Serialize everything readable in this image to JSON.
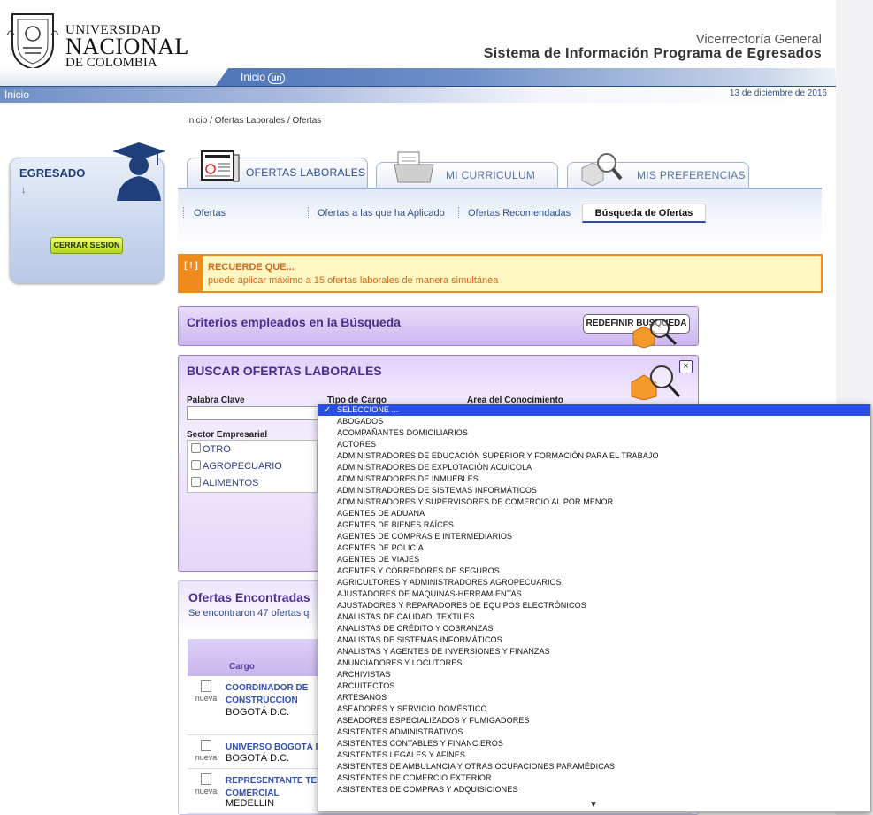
{
  "header": {
    "logo_line1": "UNIVERSIDAD",
    "logo_line2": "NACIONAL",
    "logo_line3": "DE COLOMBIA",
    "vice": "Vicerrectoría General",
    "system": "Sistema de Información Programa de Egresados",
    "nav_inicio": "Inicio",
    "nav_un": "un",
    "home": "Inicio",
    "date": "13 de diciembre de 2016"
  },
  "breadcrumb": "Inicio / Ofertas Laborales / Ofertas",
  "sidebar": {
    "title": "EGRESADO",
    "arrow": "↓",
    "logout": "CERRAR SESION"
  },
  "tabs": [
    "OFERTAS LABORALES",
    "MI CURRICULUM",
    "MIS PREFERENCIAS"
  ],
  "subnav": {
    "items": [
      "Ofertas",
      "Ofertas a las que ha Aplicado",
      "Ofertas Recomendadas"
    ],
    "active": "Búsqueda de Ofertas"
  },
  "alert": {
    "icon": "[ ! ]",
    "title": "RECUERDE QUE...",
    "message": "puede aplicar máximo a 15 ofertas laborales de manera simultánea"
  },
  "criterios": {
    "title": "Criterios empleados en la Búsqueda",
    "button": "REDEFINIR BUSQUEDA"
  },
  "buscar": {
    "title": "BUSCAR OFERTAS LABORALES",
    "close": "×",
    "label_palabra": "Palabra Clave",
    "label_tipo": "Tipo de Cargo",
    "label_area": "Area del Conocimiento",
    "label_sector": "Sector Empresarial",
    "sectors": [
      "OTRO",
      "AGROPECUARIO",
      "ALIMENTOS"
    ]
  },
  "ofertas": {
    "title": "Ofertas Encontradas",
    "summary": "Se encontraron 47 ofertas q",
    "col_cargo": "Cargo",
    "rows": [
      {
        "badge": "nueva",
        "cargo": "COORDINADOR DE CONSTRUCCION",
        "city": "BOGOTÁ D.C."
      },
      {
        "badge": "nueva",
        "cargo": "UNIVERSO BOGOTÁ I",
        "city": "BOGOTÁ D.C."
      },
      {
        "badge": "nueva",
        "cargo": "REPRESENTANTE TEC COMERCIAL",
        "city": "MEDELLIN"
      }
    ]
  },
  "dropdown": {
    "selected": "SELECCIONE ...",
    "options": [
      "SELECCIONE ...",
      "ABOGADOS",
      "ACOMPAÑANTES DOMICILIARIOS",
      "ACTORES",
      "ADMINISTRADORES DE EDUCACIÓN SUPERIOR Y FORMACIÓN PARA EL TRABAJO",
      "ADMINISTRADORES DE EXPLOTACIÓN ACUÍCOLA",
      "ADMINISTRADORES DE INMUEBLES",
      "ADMINISTRADORES DE SISTEMAS INFORMÁTICOS",
      "ADMINISTRADORES Y SUPERVISORES DE COMERCIO AL POR MENOR",
      "AGENTES DE ADUANA",
      "AGENTES DE BIENES RAÍCES",
      "AGENTES DE COMPRAS E INTERMEDIARIOS",
      "AGENTES DE POLICÍA",
      "AGENTES DE VIAJES",
      "AGENTES Y CORREDORES DE SEGUROS",
      "AGRICULTORES Y ADMINISTRADORES AGROPECUARIOS",
      "AJUSTADORES DE MAQUINAS-HERRAMIENTAS",
      "AJUSTADORES Y REPARADORES DE EQUIPOS ELECTRÓNICOS",
      "ANALISTAS DE CALIDAD, TEXTILES",
      "ANALISTAS DE CRÉDITO Y COBRANZAS",
      "ANALISTAS DE SISTEMAS INFORMÁTICOS",
      "ANALISTAS Y AGENTES DE INVERSIONES Y FINANZAS",
      "ANUNCIADORES Y LOCUTORES",
      "ARCHIVISTAS",
      "ARCUITECTOS",
      "ARTESANOS",
      "ASEADORES Y SERVICIO DOMÉSTICO",
      "ASEADORES ESPECIALIZADOS Y FUMIGADORES",
      "ASISTENTES ADMINISTRATIVOS",
      "ASISTENTES CONTABLES Y FINANCIEROS",
      "ASISTENTES LEGALES Y AFINES",
      "ASISTENTES DE AMBULANCIA Y OTRAS OCUPACIONES PARAMÉDICAS",
      "ASISTENTES DE COMERCIO EXTERIOR",
      "ASISTENTES DE COMPRAS Y ADQUISICIONES"
    ],
    "scroll_arrow": "▼"
  },
  "colors": {
    "accent": "#2f4f8f",
    "purple": "#4b2f8f",
    "alert": "#f08a1a",
    "select": "#2a4fe0"
  }
}
